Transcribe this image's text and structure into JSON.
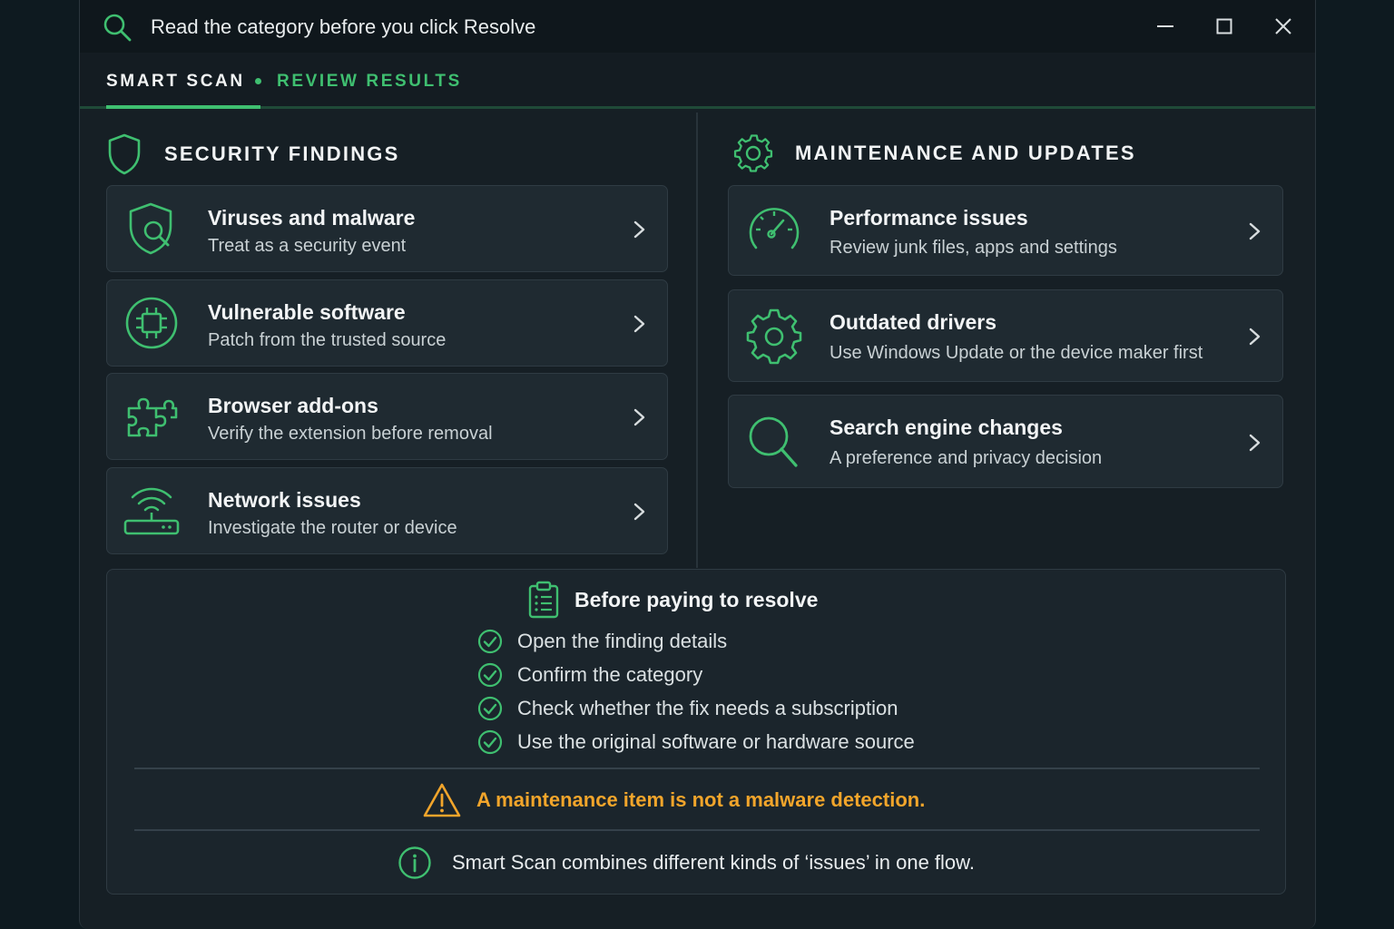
{
  "titlebar": {
    "title": "Read the category before you click Resolve"
  },
  "tabs": [
    {
      "label": "SMART SCAN",
      "active": true
    },
    {
      "label": "REVIEW RESULTS",
      "active": false
    }
  ],
  "security": {
    "heading": "SECURITY FINDINGS",
    "items": [
      {
        "title": "Viruses and malware",
        "subtitle": "Treat as a security event",
        "icon": "shield-search-icon"
      },
      {
        "title": "Vulnerable software",
        "subtitle": "Patch from the trusted source",
        "icon": "chip-icon"
      },
      {
        "title": "Browser add-ons",
        "subtitle": "Verify the extension before removal",
        "icon": "puzzle-icon"
      },
      {
        "title": "Network issues",
        "subtitle": "Investigate the router or device",
        "icon": "router-icon"
      }
    ]
  },
  "maintenance": {
    "heading": "MAINTENANCE AND UPDATES",
    "items": [
      {
        "title": "Performance issues",
        "subtitle": "Review junk files, apps and settings",
        "icon": "speedometer-icon"
      },
      {
        "title": "Outdated drivers",
        "subtitle": "Use Windows Update or the device maker first",
        "icon": "gear-icon"
      },
      {
        "title": "Search engine changes",
        "subtitle": "A preference and privacy decision",
        "icon": "search-icon"
      }
    ]
  },
  "checklist": {
    "heading": "Before paying to resolve",
    "items": [
      "Open the finding details",
      "Confirm the category",
      "Check whether the fix needs a subscription",
      "Use the original software or hardware source"
    ]
  },
  "warning": "A maintenance item is not a malware detection.",
  "info": "Smart Scan combines different kinds of ‘issues’ in one flow.",
  "colors": {
    "accent": "#3fbf70",
    "warning": "#f2a52b",
    "background": "#161f25"
  }
}
